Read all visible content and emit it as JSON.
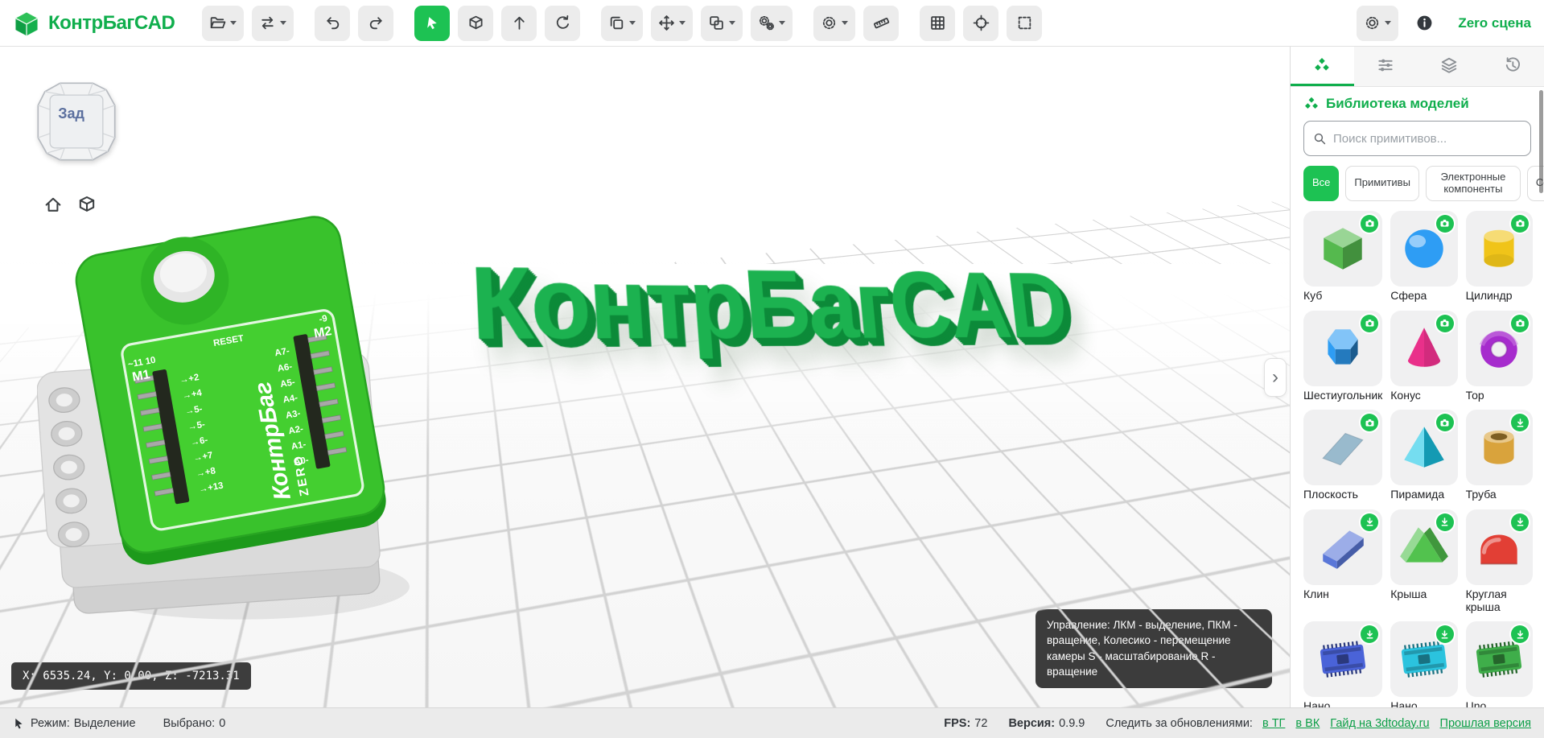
{
  "colors": {
    "accent": "#0fae4c",
    "accent_bright": "#1dc253",
    "toolbar_icon": "#3d4043",
    "text3d_fill": "#1cb250",
    "text3d_depth": "#0c8a39"
  },
  "app": {
    "title": "КонтрБагCAD",
    "scene_label": "Zero сцена"
  },
  "toolbar": {
    "groups": [
      [
        {
          "icon": "folder-open",
          "name": "open-project",
          "caret": true
        },
        {
          "icon": "swap",
          "name": "import-export",
          "caret": true
        }
      ],
      [
        {
          "icon": "undo",
          "name": "undo"
        },
        {
          "icon": "redo",
          "name": "redo"
        }
      ],
      [
        {
          "icon": "cursor",
          "name": "select-tool",
          "active": true
        },
        {
          "icon": "cube",
          "name": "box-tool"
        },
        {
          "icon": "arrow-up",
          "name": "pull-tool"
        },
        {
          "icon": "rotate",
          "name": "rotate-tool"
        }
      ],
      [
        {
          "icon": "duplicate",
          "name": "duplicate",
          "caret": true
        },
        {
          "icon": "move",
          "name": "move",
          "caret": true
        },
        {
          "icon": "group",
          "name": "group",
          "caret": true
        },
        {
          "icon": "gears",
          "name": "modifiers",
          "caret": true
        }
      ],
      [
        {
          "icon": "gear",
          "name": "settings",
          "caret": true
        },
        {
          "icon": "ruler",
          "name": "ruler"
        }
      ],
      [
        {
          "icon": "grid",
          "name": "toggle-grid"
        },
        {
          "icon": "target",
          "name": "center-view"
        },
        {
          "icon": "marquee",
          "name": "marquee-select"
        }
      ]
    ],
    "right": [
      {
        "icon": "gear",
        "name": "scene-settings",
        "caret": true
      },
      {
        "icon": "info",
        "name": "info",
        "plain": true
      }
    ]
  },
  "viewport": {
    "view_cube_label": "Зад",
    "overlay_text": "КонтрБагCAD",
    "collapse_chevron": "›",
    "coordinates": "X: 6535.24, Y: 0.00, Z: -7213.31",
    "hint": "Управление: ЛКМ - выделение, ПКМ - вращение, Колесико - перемещение камеры S - масштабирование R - вращение",
    "board": {
      "m1_top": "~11 10",
      "m1": "M1",
      "reset": "RESET",
      "m2_top": "-9",
      "m2": "M2",
      "title_line1": "КонтрБаг",
      "title_line2": "ZERO",
      "left_pins": [
        "+2",
        "+4",
        "5-",
        "5-",
        "6-",
        "+7",
        "+8",
        "+13"
      ],
      "right_pins": [
        "A7-",
        "A6-",
        "A5-",
        "A4-",
        "A3-",
        "A2-",
        "A1-",
        "A0-"
      ]
    }
  },
  "sidebar": {
    "tabs": [
      {
        "icon": "models",
        "name": "tab-model-library",
        "active": true
      },
      {
        "icon": "sliders",
        "name": "tab-properties"
      },
      {
        "icon": "layers",
        "name": "tab-layers"
      },
      {
        "icon": "history",
        "name": "tab-history"
      }
    ],
    "library_title": "Библиотека моделей",
    "search_placeholder": "Поиск примитивов...",
    "filters": [
      {
        "label": "Все",
        "active": true
      },
      {
        "label": "Примитивы"
      },
      {
        "label": "Электронные компоненты"
      },
      {
        "label": "Сообщ"
      }
    ],
    "models": [
      {
        "label": "Куб",
        "shape": "cube",
        "color": "#55b94e",
        "badge": "camera"
      },
      {
        "label": "Сфера",
        "shape": "sphere",
        "color": "#2e9df4",
        "badge": "camera"
      },
      {
        "label": "Цилиндр",
        "shape": "cylinder",
        "color": "#f0c419",
        "badge": "camera"
      },
      {
        "label": "Шестиугольник",
        "shape": "hexprism",
        "color": "#2e9df4",
        "badge": "camera"
      },
      {
        "label": "Конус",
        "shape": "cone",
        "color": "#e9308a",
        "badge": "camera"
      },
      {
        "label": "Тор",
        "shape": "torus",
        "color": "#a62ccd",
        "badge": "camera"
      },
      {
        "label": "Плоскость",
        "shape": "plane",
        "color": "#8fb4c9",
        "badge": "camera"
      },
      {
        "label": "Пирамида",
        "shape": "pyramid",
        "color": "#19c6e6",
        "badge": "camera"
      },
      {
        "label": "Труба",
        "shape": "tube",
        "color": "#d9a33c",
        "badge": "download"
      },
      {
        "label": "Клин",
        "shape": "wedge",
        "color": "#5a77d8",
        "badge": "download"
      },
      {
        "label": "Крыша",
        "shape": "roof",
        "color": "#52c24e",
        "badge": "download"
      },
      {
        "label": "Круглая крыша",
        "shape": "roundroof",
        "color": "#e23f35",
        "badge": "download"
      },
      {
        "label": "Нано",
        "shape": "board",
        "color": "#4a63d8",
        "badge": "download"
      },
      {
        "label": "Нано",
        "shape": "board",
        "color": "#2bc3de",
        "badge": "download"
      },
      {
        "label": "Uno",
        "shape": "board",
        "color": "#3fae4a",
        "badge": "download"
      }
    ]
  },
  "statusbar": {
    "mode_label": "Режим:",
    "mode_value": "Выделение",
    "selected_label": "Выбрано:",
    "selected_value": "0",
    "fps_label": "FPS:",
    "fps_value": "72",
    "version_label": "Версия:",
    "version_value": "0.9.9",
    "follow_label": "Следить за обновлениями:",
    "links": [
      "в ТГ",
      "в ВК",
      "Гайд на 3dtoday.ru",
      "Прошлая версия"
    ]
  }
}
